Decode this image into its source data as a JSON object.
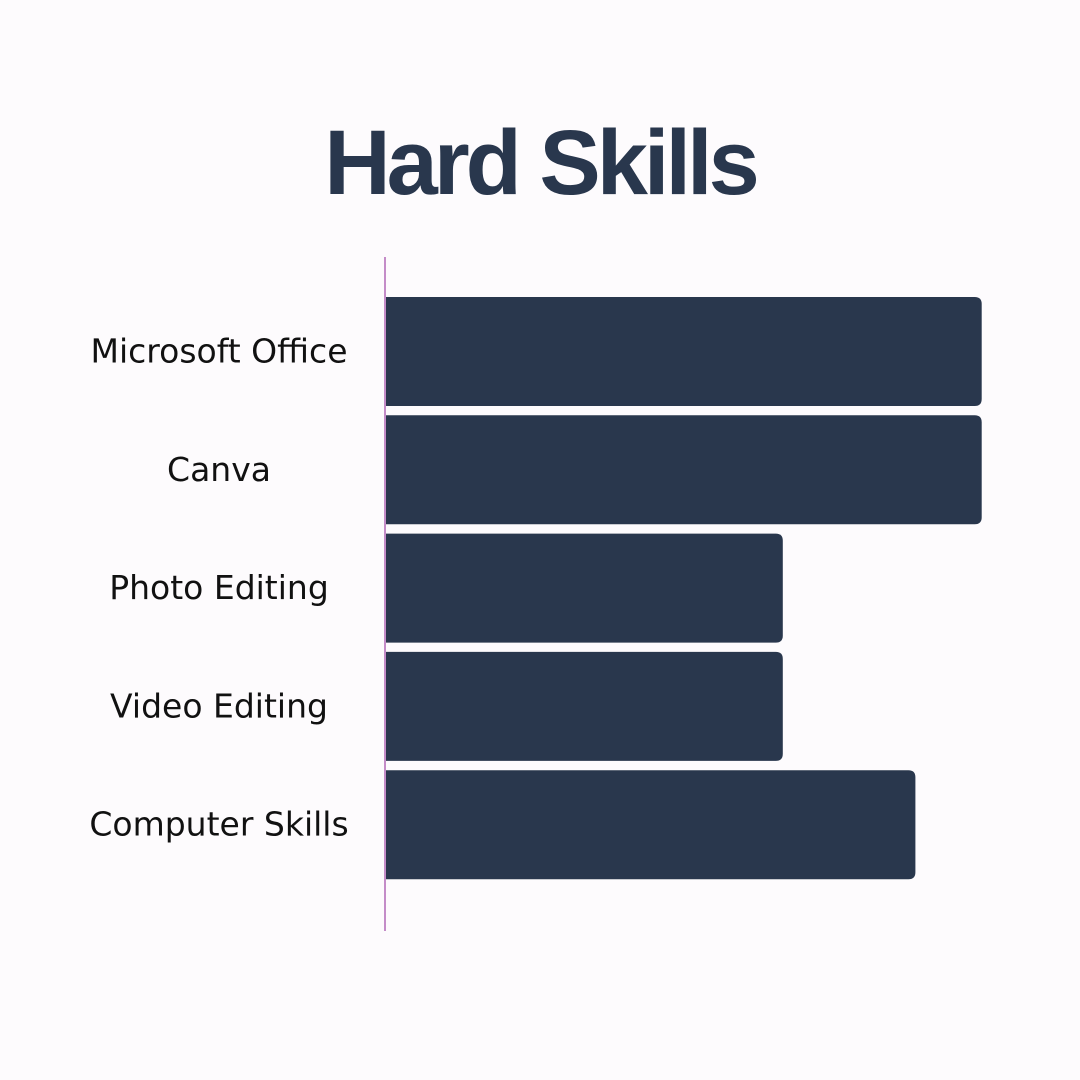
{
  "chart_data": {
    "type": "bar",
    "orientation": "horizontal",
    "title": "Hard Skills",
    "categories": [
      "Microsoft Office",
      "Canva",
      "Photo Editing",
      "Video Editing",
      "Computer Skills"
    ],
    "values": [
      90,
      90,
      60,
      60,
      80
    ],
    "xlim": [
      0,
      100
    ],
    "grid": false,
    "legend": "none"
  },
  "colors": {
    "background": "#fdfbfd",
    "bar": "#29374d",
    "title": "#29374d",
    "label": "#111111",
    "axis": "#c48cc8"
  }
}
